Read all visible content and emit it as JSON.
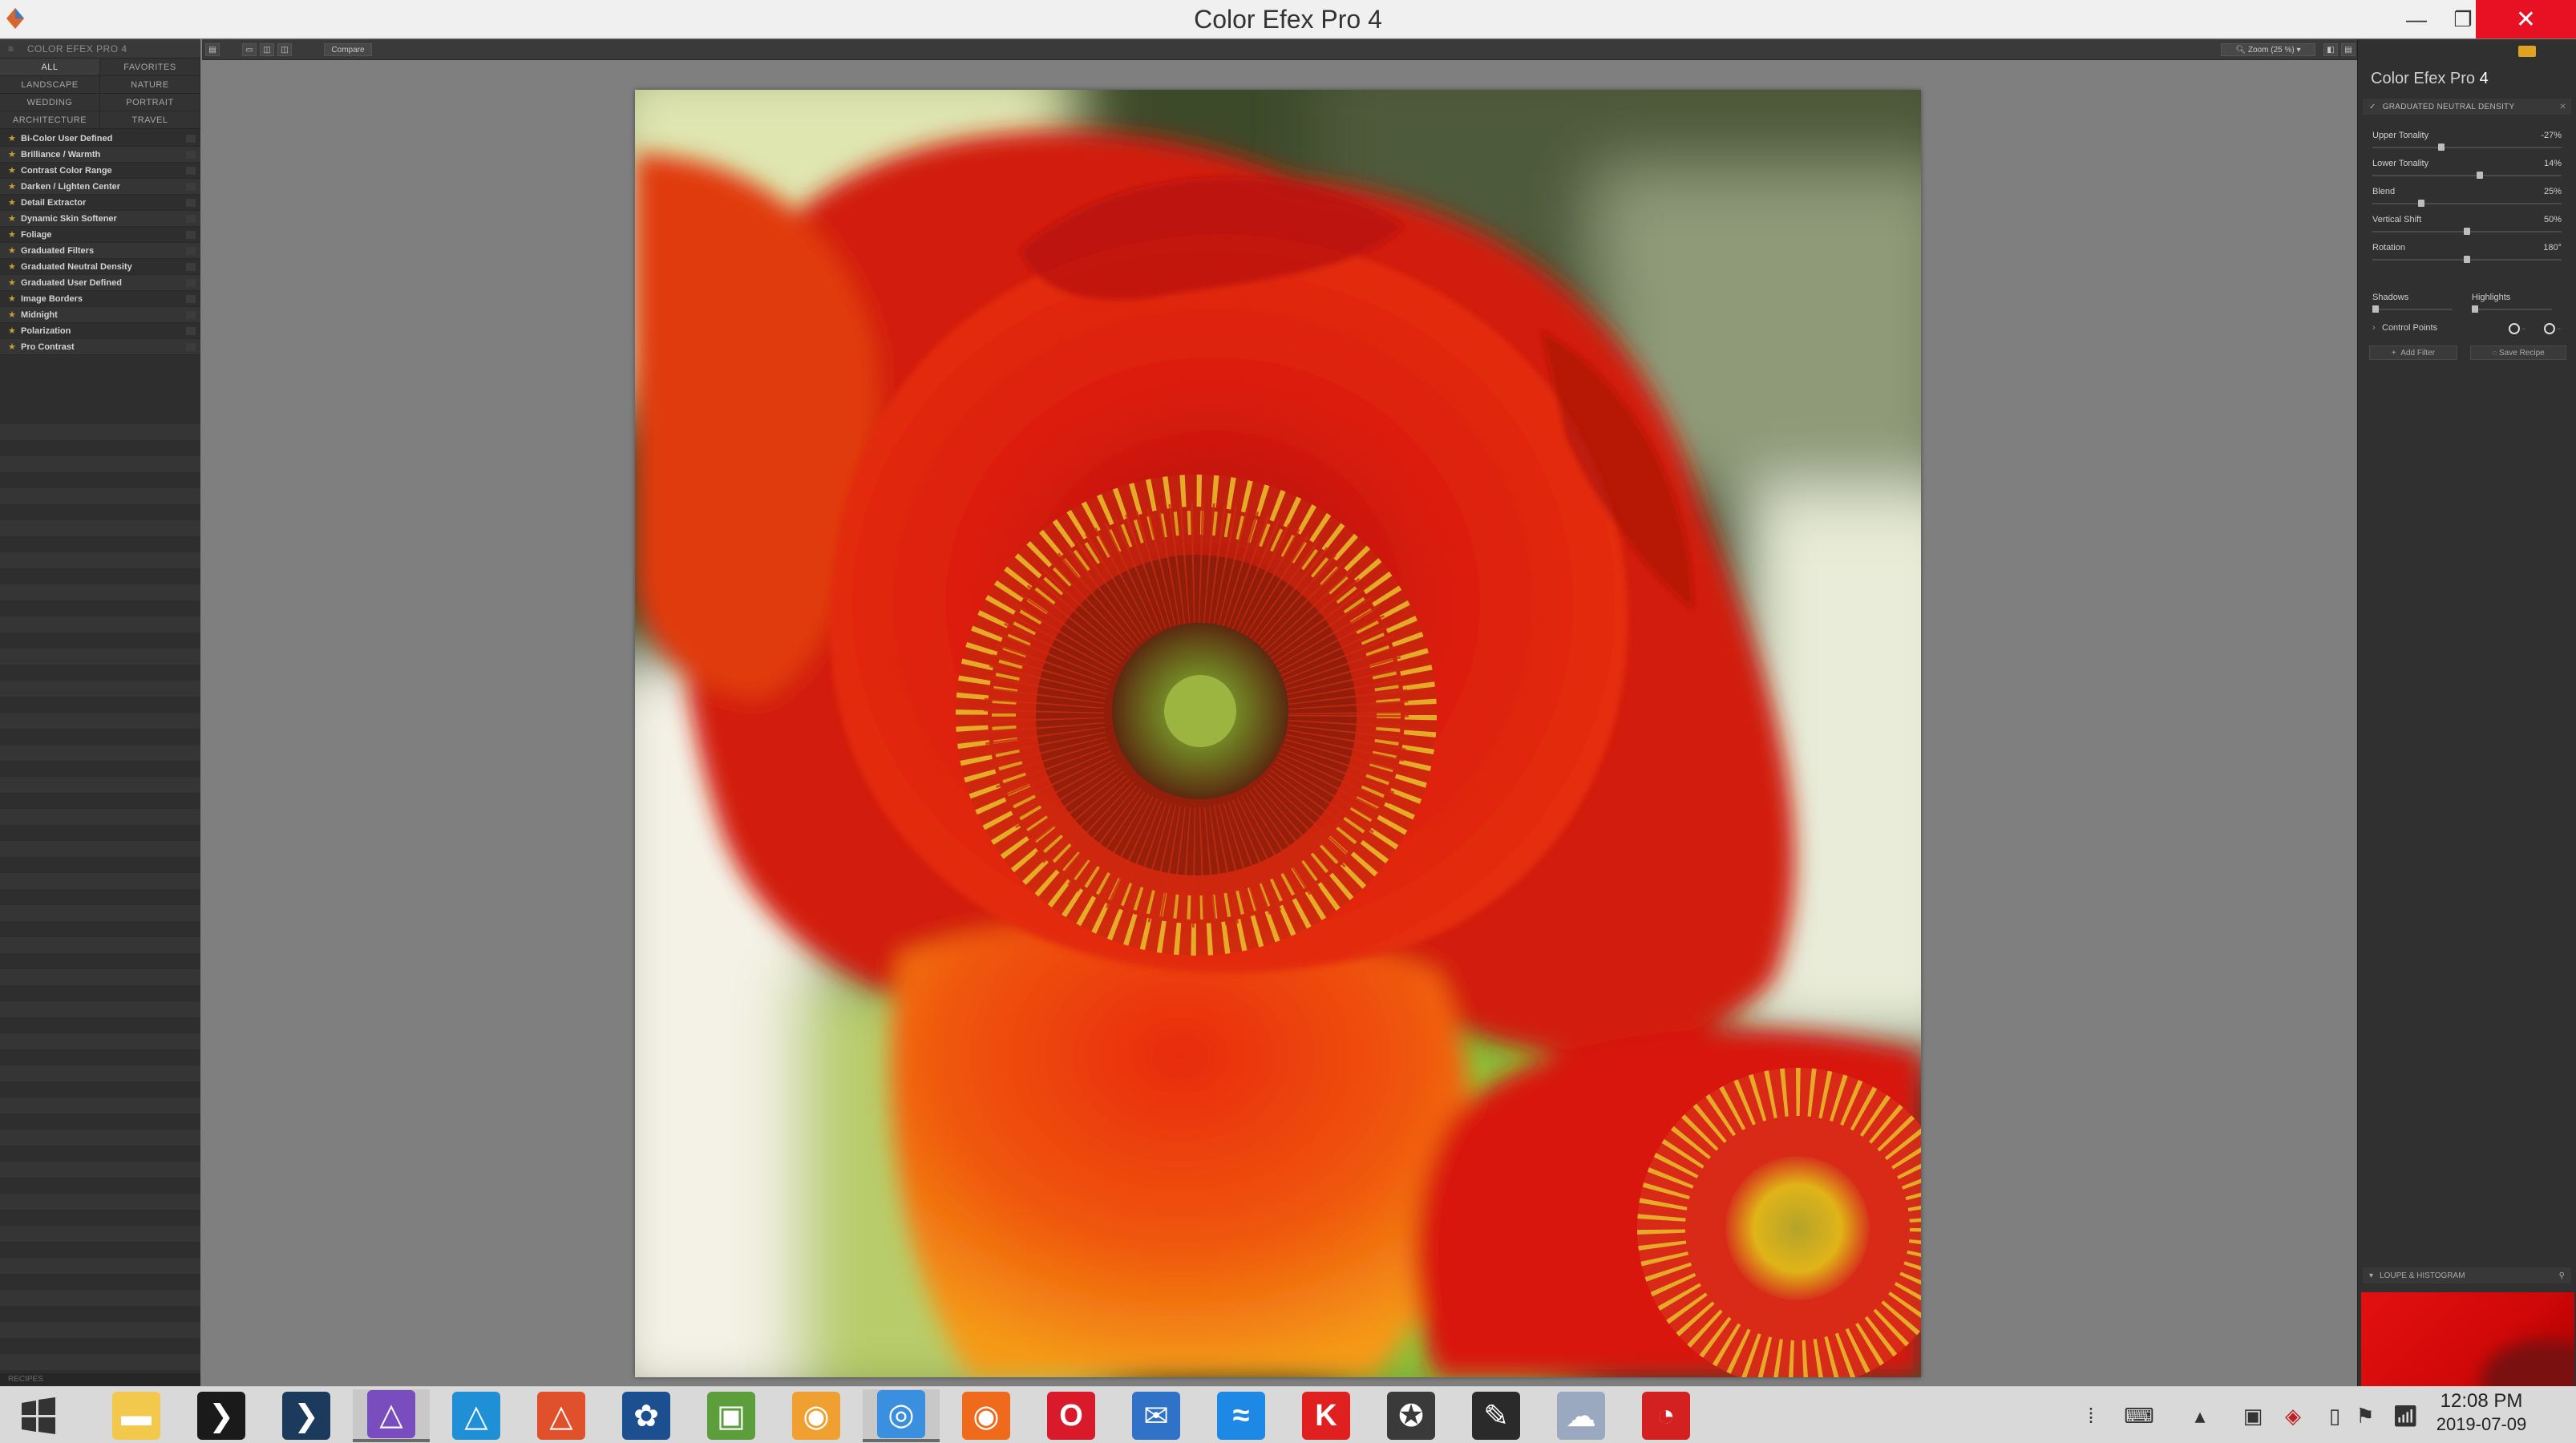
{
  "window": {
    "title": "Color Efex Pro 4"
  },
  "left_panel": {
    "header": "COLOR EFEX PRO 4",
    "categories": [
      "ALL",
      "FAVORITES",
      "LANDSCAPE",
      "NATURE",
      "WEDDING",
      "PORTRAIT",
      "ARCHITECTURE",
      "TRAVEL"
    ],
    "filters": [
      "Bi-Color User Defined",
      "Brilliance / Warmth",
      "Contrast Color Range",
      "Darken / Lighten Center",
      "Detail Extractor",
      "Dynamic Skin Softener",
      "Foliage",
      "Graduated Filters",
      "Graduated Neutral Density",
      "Graduated User Defined",
      "Image Borders",
      "Midnight",
      "Polarization",
      "Pro Contrast"
    ],
    "recipes_label": "RECIPES"
  },
  "toolbar": {
    "compare_label": "Compare",
    "zoom_label": "Zoom (25 %)"
  },
  "right_panel": {
    "brand": "Color Efex Pro",
    "brand_version": "4",
    "filter_name": "GRADUATED NEUTRAL DENSITY",
    "sliders": [
      {
        "label": "Upper Tonality",
        "value": "-27%",
        "position": 0.36
      },
      {
        "label": "Lower Tonality",
        "value": "14%",
        "position": 0.57
      },
      {
        "label": "Blend",
        "value": "25%",
        "position": 0.25
      },
      {
        "label": "Vertical Shift",
        "value": "50%",
        "position": 0.5
      },
      {
        "label": "Rotation",
        "value": "180°",
        "position": 0.5
      }
    ],
    "shadows_label": "Shadows",
    "highlights_label": "Highlights",
    "control_points_label": "Control Points",
    "add_filter_label": "Add Filter",
    "save_recipe_label": "Save Recipe",
    "loupe_label": "LOUPE & HISTOGRAM"
  },
  "taskbar": {
    "time": "12:08 PM",
    "date": "2019-07-09",
    "apps": [
      {
        "name": "file-explorer-icon",
        "color": "#f2c94c",
        "glyph": "▬"
      },
      {
        "name": "affinity-designer-dark-icon",
        "color": "#1a1a1a",
        "glyph": "❯"
      },
      {
        "name": "powershell-icon",
        "color": "#1b3a5c",
        "glyph": "❯"
      },
      {
        "name": "affinity-photo-icon",
        "color": "#7a4dbf",
        "glyph": "△"
      },
      {
        "name": "affinity-designer-icon",
        "color": "#1f8fd6",
        "glyph": "△"
      },
      {
        "name": "affinity-publisher-icon",
        "color": "#e0502a",
        "glyph": "△"
      },
      {
        "name": "capture-one-icon",
        "color": "#1c4f8f",
        "glyph": "✿"
      },
      {
        "name": "photo-viewer-icon",
        "color": "#5c9e3c",
        "glyph": "▣"
      },
      {
        "name": "preview-eye-icon",
        "color": "#f0a030",
        "glyph": "◉"
      },
      {
        "name": "chrome-icon",
        "color": "#3a8fde",
        "glyph": "◎"
      },
      {
        "name": "firefox-icon",
        "color": "#f06a1c",
        "glyph": "◉"
      },
      {
        "name": "opera-icon",
        "color": "#d91a2a",
        "glyph": "O"
      },
      {
        "name": "thunderbird-icon",
        "color": "#2f72c8",
        "glyph": "✉"
      },
      {
        "name": "swift-icon",
        "color": "#1e88e5",
        "glyph": "≈"
      },
      {
        "name": "k-app-icon",
        "color": "#e01f1f",
        "glyph": "K"
      },
      {
        "name": "bee-app-icon",
        "color": "#3a3a3a",
        "glyph": "✪"
      },
      {
        "name": "pencil-app-icon",
        "color": "#2a2a2a",
        "glyph": "✎"
      },
      {
        "name": "ultrasonic-icon",
        "color": "#9aa9bf",
        "glyph": "☁"
      },
      {
        "name": "clock-app-icon",
        "color": "#d32020",
        "glyph": "◔"
      }
    ]
  }
}
